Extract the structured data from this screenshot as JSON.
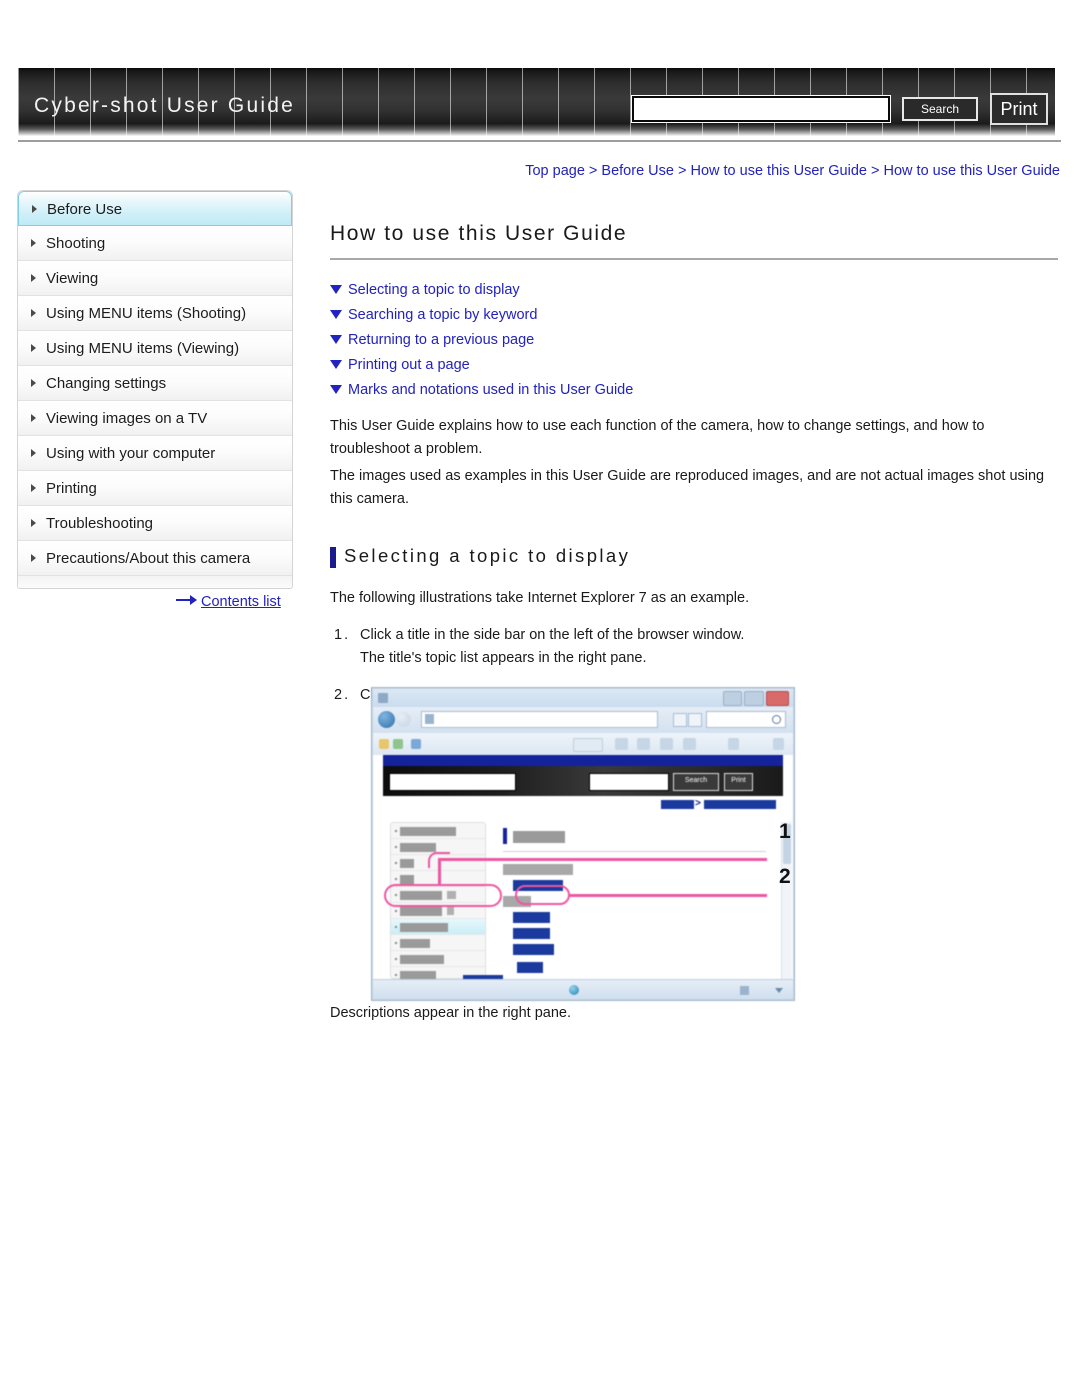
{
  "header": {
    "title": "Cyber-shot User Guide",
    "search_value": "",
    "search_placeholder": "",
    "search_label": "Search",
    "print_label": "Print"
  },
  "breadcrumb": {
    "text": "Top page > Before Use > How to use this User Guide > How to use this User Guide"
  },
  "sidebar": {
    "items": [
      {
        "label": "Before Use",
        "selected": true
      },
      {
        "label": "Shooting",
        "selected": false
      },
      {
        "label": "Viewing",
        "selected": false
      },
      {
        "label": "Using MENU items (Shooting)",
        "selected": false
      },
      {
        "label": "Using MENU items (Viewing)",
        "selected": false
      },
      {
        "label": "Changing settings",
        "selected": false
      },
      {
        "label": "Viewing images on a TV",
        "selected": false
      },
      {
        "label": "Using with your computer",
        "selected": false
      },
      {
        "label": "Printing",
        "selected": false
      },
      {
        "label": "Troubleshooting",
        "selected": false
      },
      {
        "label": "Precautions/About this camera",
        "selected": false
      }
    ],
    "contents_list_label": "Contents list"
  },
  "main": {
    "page_title": "How to use this User Guide",
    "topic_links": [
      "Selecting a topic to display",
      "Searching a topic by keyword",
      "Returning to a previous page",
      "Printing out a page",
      "Marks and notations used in this User Guide"
    ],
    "intro_paragraph_1": "This User Guide explains how to use each function of the camera, how to change settings, and how to troubleshoot a problem.",
    "intro_paragraph_2": "The images used as examples in this User Guide are reproduced images, and are not actual images shot using this camera.",
    "section_heading": "Selecting a topic to display",
    "section_intro": "The following illustrations take Internet Explorer 7 as an example.",
    "steps": [
      {
        "number": "1.",
        "line1": "Click a title in the side bar on the left of the browser window.",
        "line2": "The title's topic list appears in the right pane."
      },
      {
        "number": "2.",
        "line1": "Click a topic title in the list.",
        "line2": ""
      }
    ],
    "closing_line": "Descriptions appear in the right pane.",
    "illustration": {
      "callout_1": "1",
      "callout_2": "2",
      "ie_search_label": "Search",
      "ie_print_label": "Print"
    }
  },
  "colors": {
    "link_blue": "#2222c0",
    "accent_navy": "#1b1b8f",
    "callout_pink": "#ef56a2",
    "highlight_cyan": "#cdeff7",
    "header_dark": "#2e2e2e"
  }
}
